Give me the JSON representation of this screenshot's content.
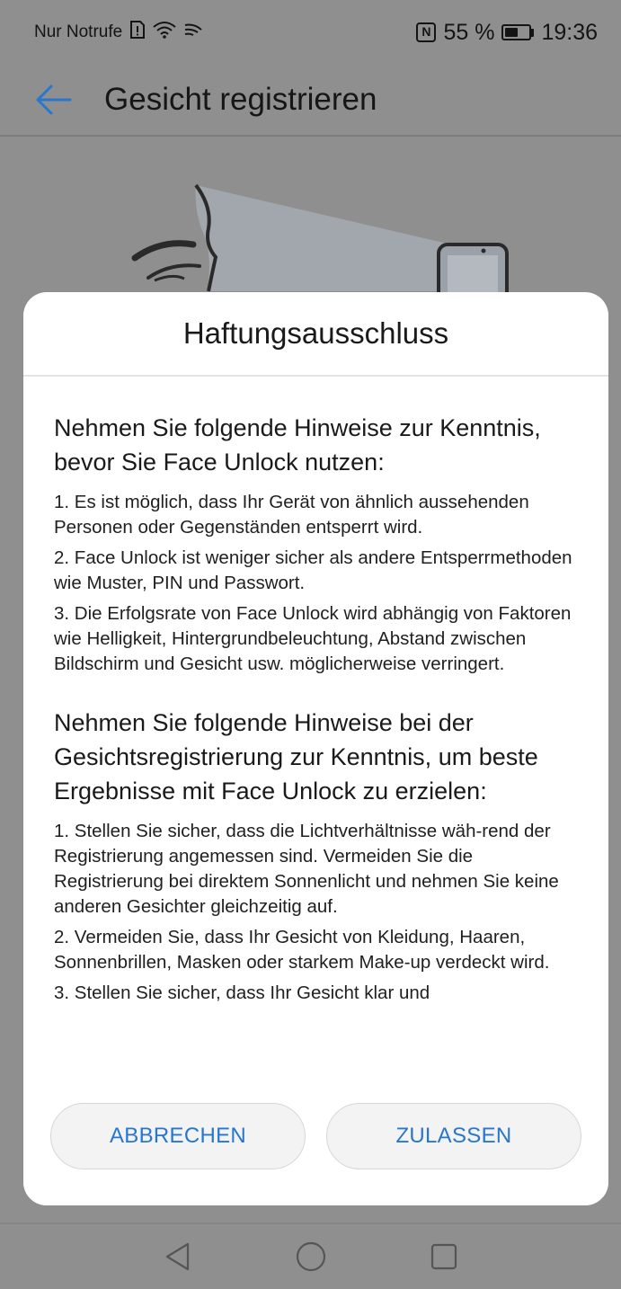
{
  "status_bar": {
    "carrier": "Nur Notrufe",
    "battery": "55 %",
    "time": "19:36",
    "icons": [
      "sim-alert-icon",
      "wifi-icon",
      "cast-icon",
      "nfc-icon",
      "battery-icon"
    ]
  },
  "app_bar": {
    "title": "Gesicht registrieren",
    "back_icon": "arrow-left-icon"
  },
  "dialog": {
    "title": "Haftungsausschluss",
    "sections": [
      {
        "heading": "Nehmen Sie folgende Hinweise zur Kenntnis, bevor Sie Face Unlock nutzen:",
        "items": [
          "1. Es ist möglich, dass Ihr Gerät von ähnlich aussehenden Personen oder Gegenständen entsperrt wird.",
          "2. Face Unlock ist weniger sicher als andere Entsperrmethoden wie Muster, PIN und Passwort.",
          "3. Die Erfolgsrate von Face Unlock wird abhängig von Faktoren wie Helligkeit, Hintergrundbeleuchtung, Abstand zwischen Bildschirm und Gesicht usw. möglicherweise verringert."
        ]
      },
      {
        "heading": "Nehmen Sie folgende Hinweise bei der Gesichtsregistrierung zur Kenntnis, um beste Ergebnisse mit Face Unlock zu erzielen:",
        "items": [
          "1. Stellen Sie sicher, dass die Lichtverhältnisse wäh-rend der Registrierung angemessen sind. Vermeiden Sie die Registrierung bei direktem Sonnenlicht und nehmen Sie keine anderen Gesichter gleichzeitig auf.",
          "2. Vermeiden Sie, dass Ihr Gesicht von Kleidung, Haaren, Sonnenbrillen, Masken oder starkem Make-up verdeckt wird.",
          "3. Stellen Sie sicher, dass Ihr Gesicht klar und"
        ]
      }
    ],
    "buttons": {
      "cancel": "ABBRECHEN",
      "allow": "ZULASSEN"
    }
  },
  "nav_bar": {
    "icons": [
      "back-triangle-icon",
      "home-circle-icon",
      "recents-square-icon"
    ]
  },
  "colors": {
    "accent": "#2877cc",
    "scrim_background": "#8f8f8f",
    "dialog_background": "#ffffff"
  }
}
